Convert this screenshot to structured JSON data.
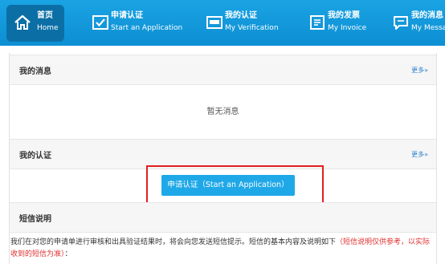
{
  "nav": {
    "items": [
      {
        "zh": "首页",
        "en": "Home",
        "icon": "home-icon",
        "active": true
      },
      {
        "zh": "申请认证",
        "en": "Start an Application",
        "icon": "apply-icon"
      },
      {
        "zh": "我的认证",
        "en": "My Verification",
        "icon": "verification-icon"
      },
      {
        "zh": "我的发票",
        "en": "My Invoice",
        "icon": "invoice-icon"
      },
      {
        "zh": "我的消息",
        "en": "My Messa",
        "icon": "message-icon"
      }
    ]
  },
  "messages": {
    "title": "我的消息",
    "more": "更多»",
    "empty": "暂无消息"
  },
  "verification": {
    "title": "我的认证",
    "more": "更多»",
    "apply_button": "申请认证（Start an Application）"
  },
  "sms": {
    "title": "短信说明",
    "text": "我们在对您的申请单进行审核和出具验证结果时，将会向您发送短信提示。短信的基本内容及说明如下",
    "highlight": "（短信说明仅供参考，以实际收到的短信为准）",
    "suffix": "："
  },
  "colors": {
    "nav_bg": "#1aa3e3",
    "nav_active": "#0b6fa6",
    "button": "#1fa8e8",
    "highlight_border": "#e02020"
  }
}
